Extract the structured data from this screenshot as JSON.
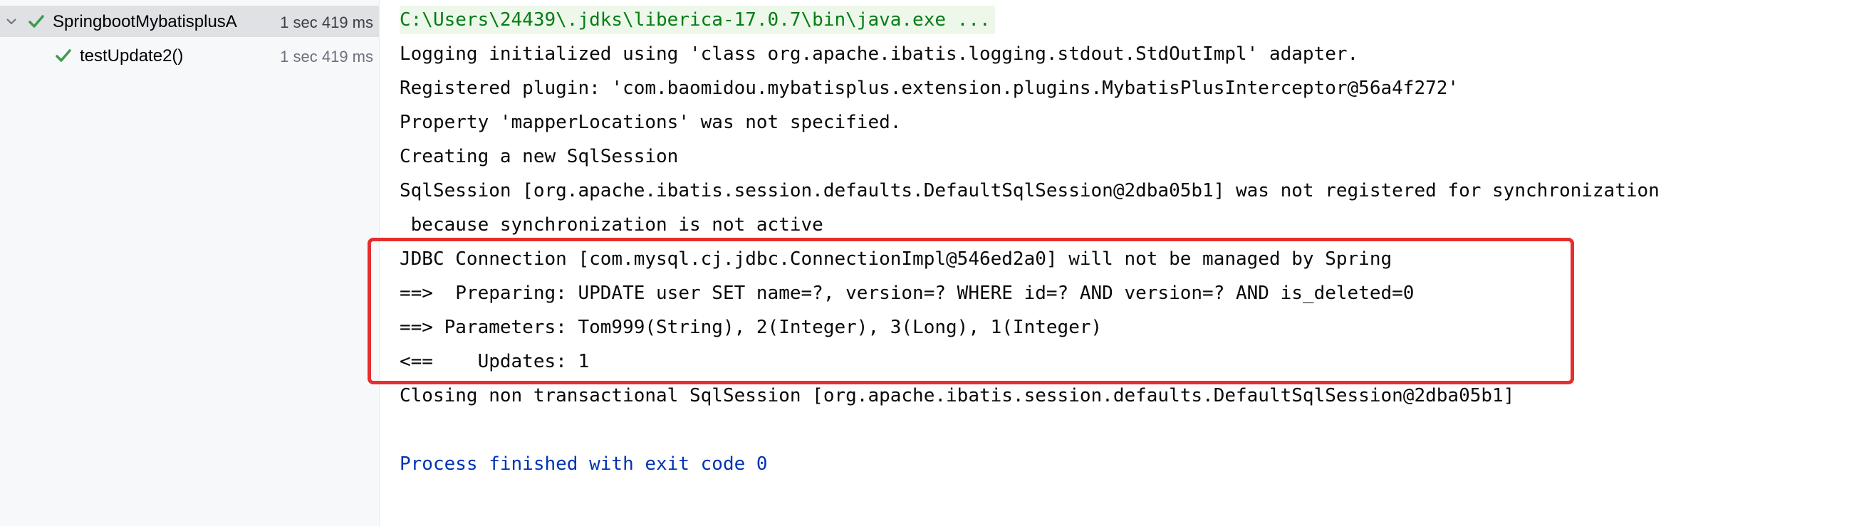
{
  "test_tree": {
    "root": {
      "label": "SpringbootMybatisplusA",
      "time": "1 sec 419 ms"
    },
    "child": {
      "label": "testUpdate2()",
      "time": "1 sec 419 ms"
    }
  },
  "console": {
    "lines": [
      "C:\\Users\\24439\\.jdks\\liberica-17.0.7\\bin\\java.exe ...",
      "Logging initialized using 'class org.apache.ibatis.logging.stdout.StdOutImpl' adapter.",
      "Registered plugin: 'com.baomidou.mybatisplus.extension.plugins.MybatisPlusInterceptor@56a4f272'",
      "Property 'mapperLocations' was not specified.",
      "Creating a new SqlSession",
      "SqlSession [org.apache.ibatis.session.defaults.DefaultSqlSession@2dba05b1] was not registered for synchronization",
      " because synchronization is not active",
      "JDBC Connection [com.mysql.cj.jdbc.ConnectionImpl@546ed2a0] will not be managed by Spring",
      "==>  Preparing: UPDATE user SET name=?, version=? WHERE id=? AND version=? AND is_deleted=0",
      "==> Parameters: Tom999(String), 2(Integer), 3(Long), 1(Integer)",
      "<==    Updates: 1",
      "Closing non transactional SqlSession [org.apache.ibatis.session.defaults.DefaultSqlSession@2dba05b1]",
      "",
      "Process finished with exit code 0"
    ]
  },
  "colors": {
    "pass_check": "#3d9b4a",
    "command_text": "#067d17",
    "command_bg": "#edf7ea",
    "exit_text": "#0033b3",
    "annotation_box": "#e52e2e"
  },
  "icons": {
    "expand": "chevron-down-icon",
    "passed": "check-icon"
  }
}
